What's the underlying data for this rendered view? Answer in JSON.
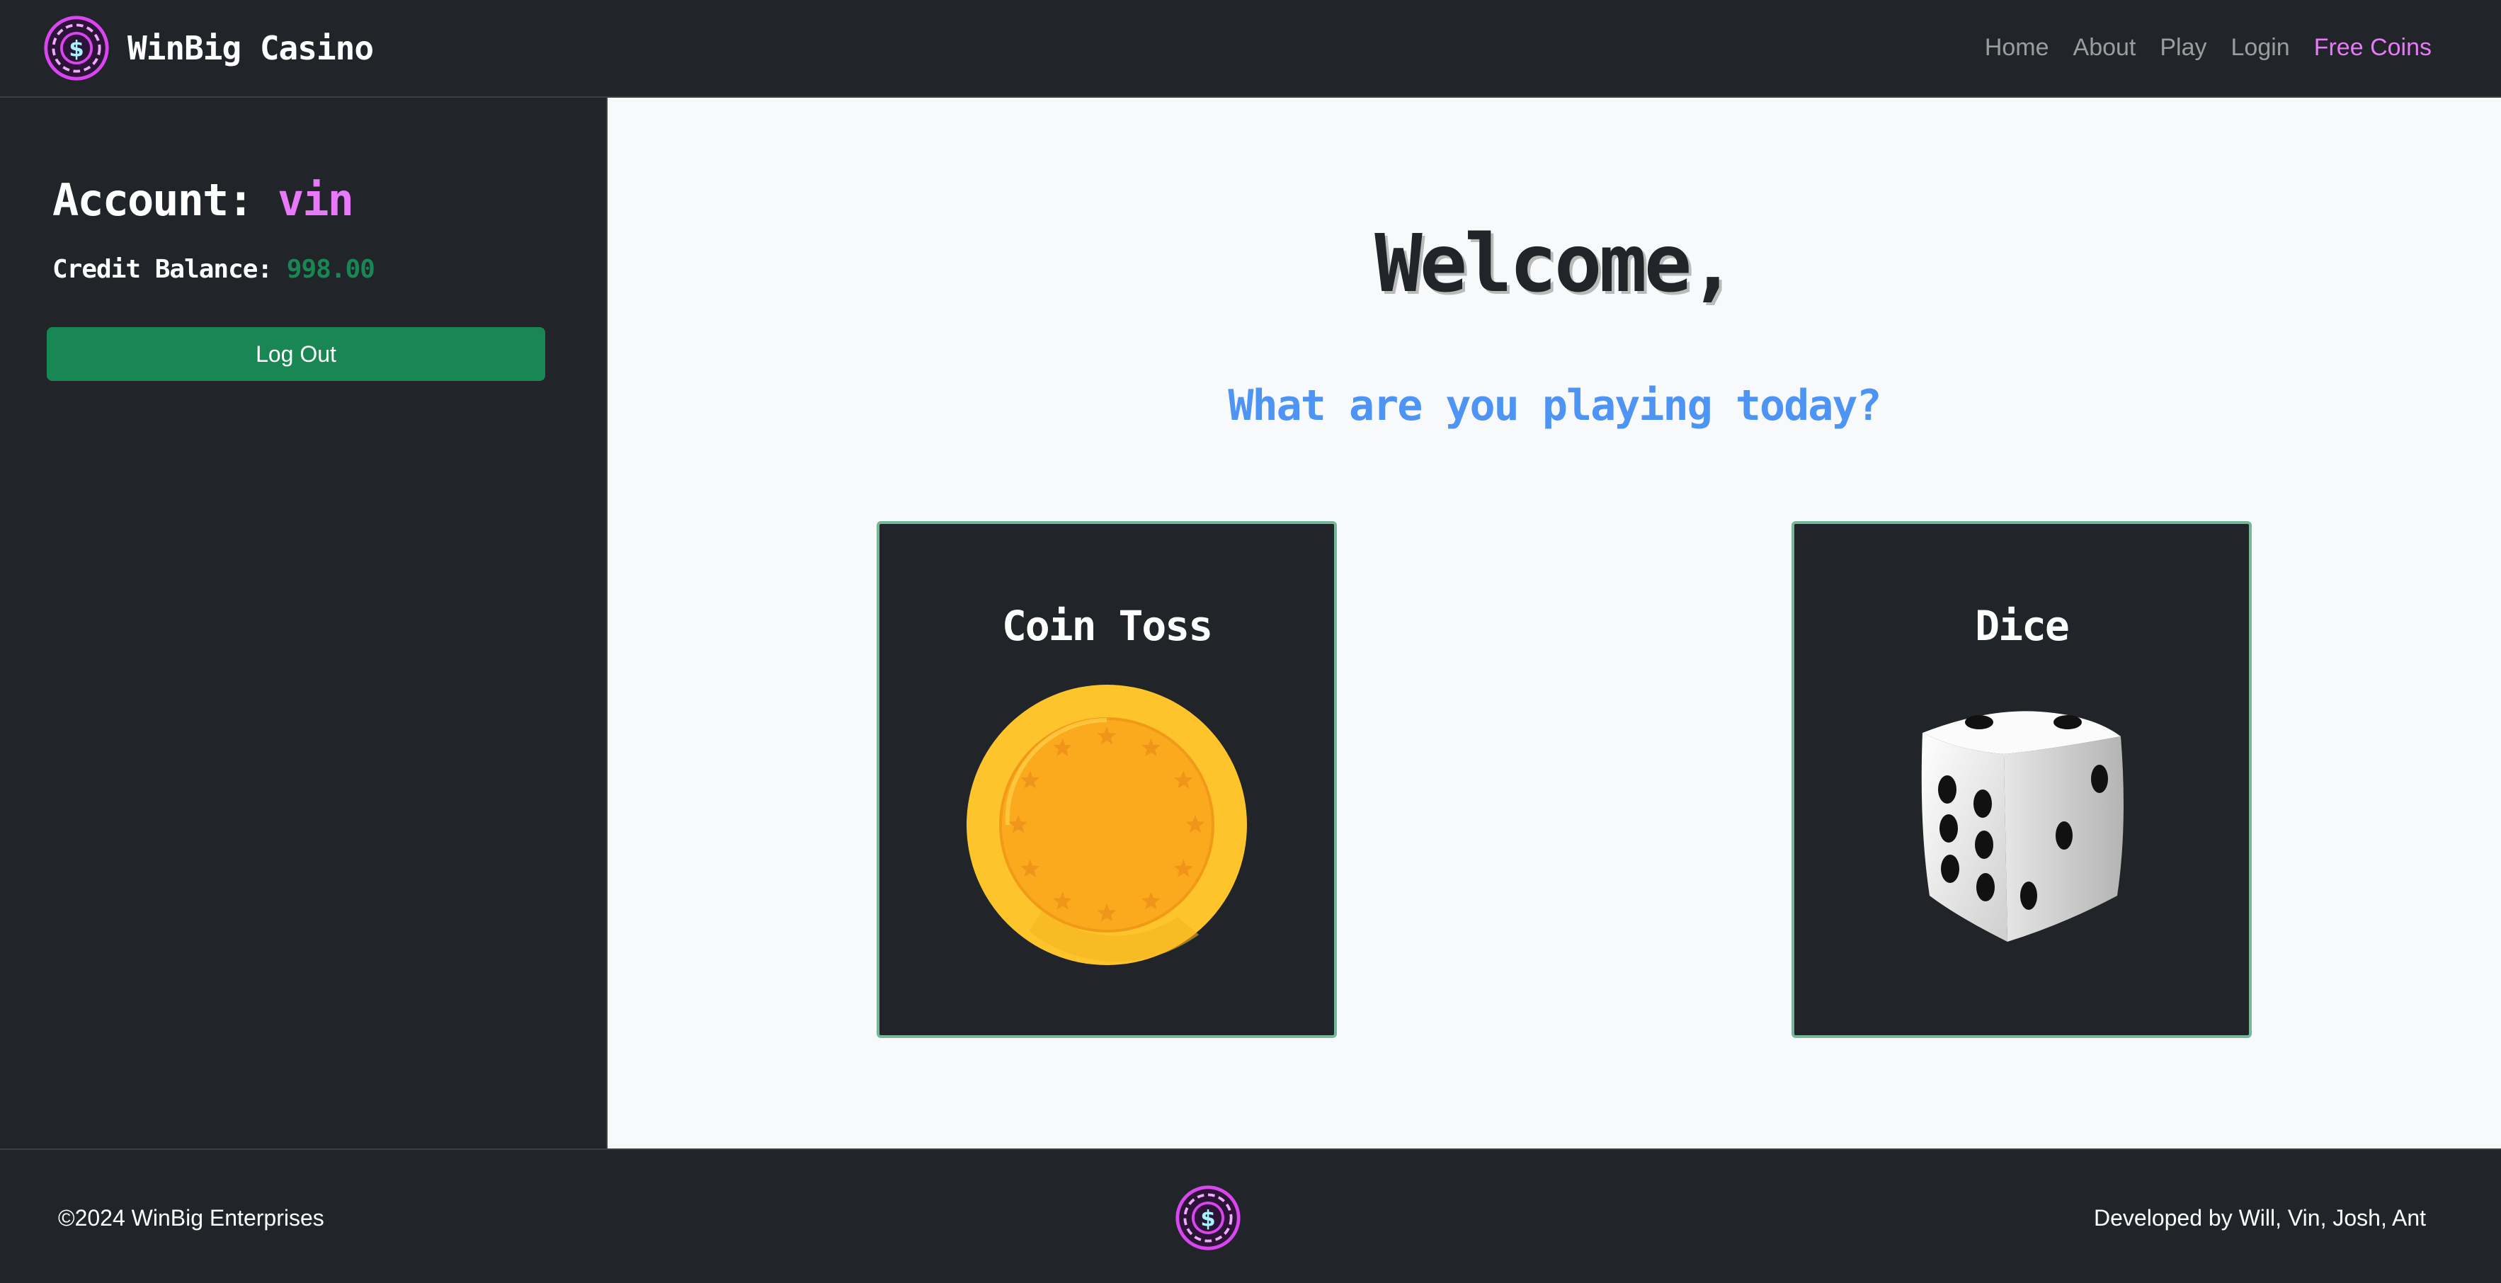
{
  "navbar": {
    "brand": "WinBig Casino",
    "links": [
      {
        "label": "Home"
      },
      {
        "label": "About"
      },
      {
        "label": "Play"
      },
      {
        "label": "Login"
      },
      {
        "label": "Free Coins"
      }
    ]
  },
  "sidebar": {
    "account_label": "Account:",
    "account_name": "vin",
    "balance_label": "Credit Balance:",
    "balance_value": "998.00",
    "logout_label": "Log Out"
  },
  "main": {
    "welcome": "Welcome,",
    "subtitle": "What are you playing today?",
    "games": [
      {
        "title": "Coin Toss",
        "icon": "coin-icon"
      },
      {
        "title": "Dice",
        "icon": "dice-icon"
      }
    ]
  },
  "footer": {
    "copyright": "©2024 WinBig Enterprises",
    "credits": "Developed by Will, Vin, Josh, Ant"
  },
  "colors": {
    "background_dark": "#212529",
    "main_background": "#f8f9fa",
    "accent_pink": "#e879f9",
    "success_green": "#198754",
    "subtitle_blue": "#4d94f5",
    "card_border": "#75b798"
  }
}
